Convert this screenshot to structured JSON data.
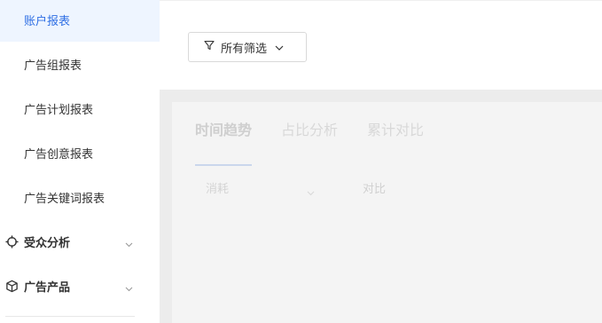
{
  "sidebar": {
    "items": [
      {
        "label": "账户报表"
      },
      {
        "label": "广告组报表"
      },
      {
        "label": "广告计划报表"
      },
      {
        "label": "广告创意报表"
      },
      {
        "label": "广告关键词报表"
      }
    ],
    "groups": [
      {
        "label": "受众分析",
        "icon": "audience-target-icon"
      },
      {
        "label": "广告产品",
        "icon": "product-box-icon"
      }
    ],
    "active_color": "#2f6fe4"
  },
  "toolbar": {
    "filter_label": "所有筛选"
  },
  "report": {
    "tabs": [
      {
        "label": "时间趋势"
      },
      {
        "label": "占比分析"
      },
      {
        "label": "累计对比"
      }
    ],
    "metric_select": "消耗",
    "compare_label": "对比"
  }
}
